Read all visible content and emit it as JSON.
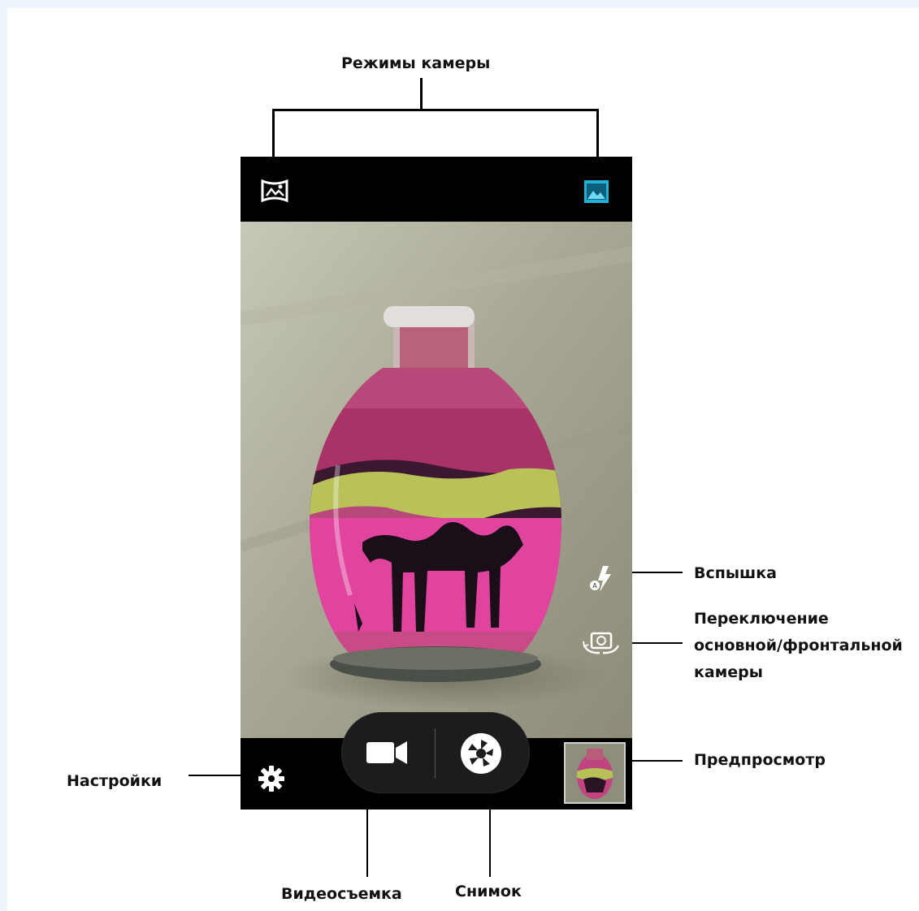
{
  "annotations": {
    "camera_modes": "Режимы камеры",
    "flash": "Вспышка",
    "switch_camera": [
      "Переключение",
      "основной/фронтальной",
      "камеры"
    ],
    "preview": "Предпросмотр",
    "settings": "Настройки",
    "video": "Видеосъемка",
    "shot": "Снимок"
  },
  "colors": {
    "phone_bg": "#000000",
    "accent": "#20b1d9",
    "icon_white": "#ffffff"
  },
  "icons": {
    "panorama_mode": "panorama-icon",
    "photo_mode": "photo-mode-icon",
    "flash": "flash-auto-icon",
    "switch_camera": "switch-camera-icon",
    "settings": "gear-icon",
    "video": "video-camera-icon",
    "shutter": "shutter-icon",
    "flash_auto_letter": "A"
  }
}
